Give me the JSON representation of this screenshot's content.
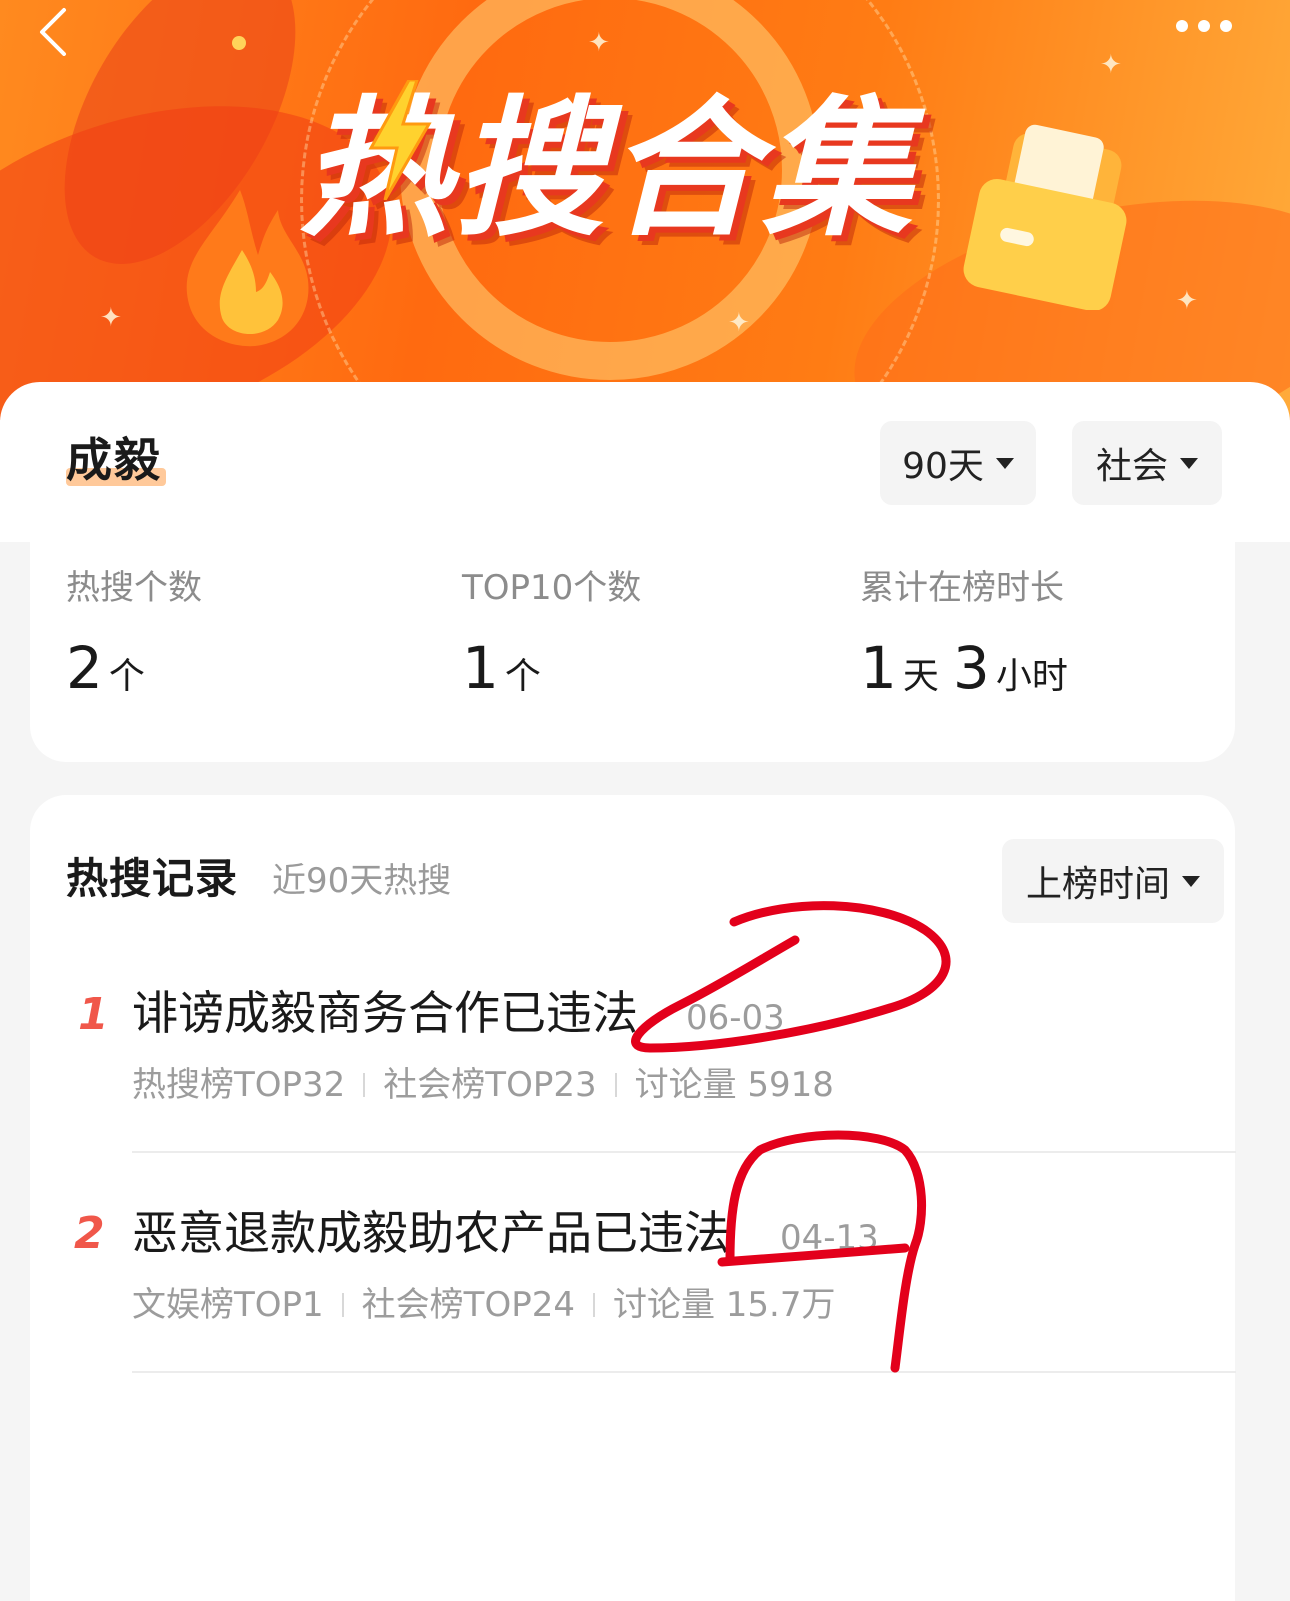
{
  "banner": {
    "title": "热搜合集"
  },
  "profile": {
    "name": "成毅"
  },
  "filters": {
    "days": "90天",
    "category": "社会"
  },
  "stats": {
    "count_label": "热搜个数",
    "count_value": "2",
    "count_unit": "个",
    "top10_label": "TOP10个数",
    "top10_value": "1",
    "top10_unit": "个",
    "duration_label": "累计在榜时长",
    "duration_days": "1",
    "duration_days_unit": "天",
    "duration_hours": "3",
    "duration_hours_unit": "小时"
  },
  "records": {
    "title": "热搜记录",
    "subtitle": "近90天热搜",
    "sort_label": "上榜时间",
    "items": [
      {
        "rank": "1",
        "title": "诽谤成毅商务合作已违法",
        "date": "06-03",
        "tag1": "热搜榜TOP32",
        "tag2": "社会榜TOP23",
        "discussion": "讨论量 5918"
      },
      {
        "rank": "2",
        "title": "恶意退款成毅助农产品已违法",
        "date": "04-13",
        "tag1": "文娱榜TOP1",
        "tag2": "社会榜TOP24",
        "discussion": "讨论量 15.7万"
      }
    ]
  },
  "colors": {
    "banner_orange": "#ff6a10",
    "rank_red": "#f0574a",
    "scribble_red": "#e3001b"
  },
  "icons": {
    "back": "chevron-left-icon",
    "more": "more-dots-icon",
    "dropdown": "caret-down-icon"
  }
}
